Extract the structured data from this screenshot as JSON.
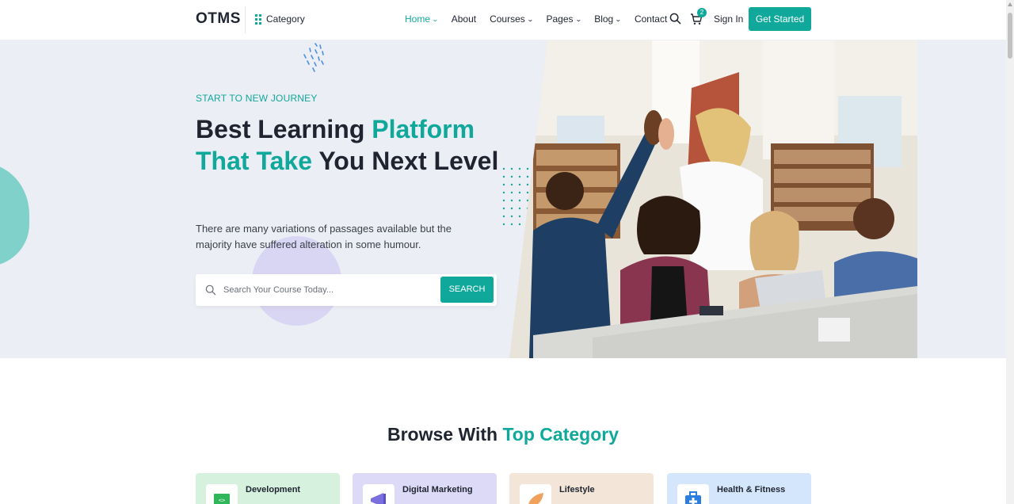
{
  "header": {
    "logo": "OTMS",
    "category_label": "Category",
    "nav": [
      {
        "label": "Home",
        "active": true,
        "dropdown": true
      },
      {
        "label": "About",
        "active": false,
        "dropdown": false
      },
      {
        "label": "Courses",
        "active": false,
        "dropdown": true
      },
      {
        "label": "Pages",
        "active": false,
        "dropdown": true
      },
      {
        "label": "Blog",
        "active": false,
        "dropdown": true
      },
      {
        "label": "Contact",
        "active": false,
        "dropdown": false
      }
    ],
    "cart_count": "2",
    "signin_label": "Sign In",
    "cta_label": "Get Started"
  },
  "hero": {
    "subtitle": "START TO NEW JOURNEY",
    "headline_part1": "Best Learning ",
    "headline_accent": "Platform That Take",
    "headline_part2": " You Next Level",
    "description": "There are many variations of passages available but the majority have suffered alteration in some humour.",
    "search_placeholder": "Search Your Course Today...",
    "search_button": "SEARCH"
  },
  "browse": {
    "title_part1": "Browse With ",
    "title_accent": "Top Category",
    "categories": [
      {
        "name": "Development",
        "bg": "#d6f1de",
        "icon": "code-icon"
      },
      {
        "name": "Digital Marketing",
        "bg": "#dcdaf7",
        "icon": "megaphone-icon"
      },
      {
        "name": "Lifestyle",
        "bg": "#f3e5d8",
        "icon": "leaf-icon"
      },
      {
        "name": "Health & Fitness",
        "bg": "#d4e6fb",
        "icon": "medical-kit-icon"
      }
    ]
  },
  "colors": {
    "accent": "#0fa89a",
    "dark": "#1f2430",
    "hero_bg": "#eceef5"
  }
}
